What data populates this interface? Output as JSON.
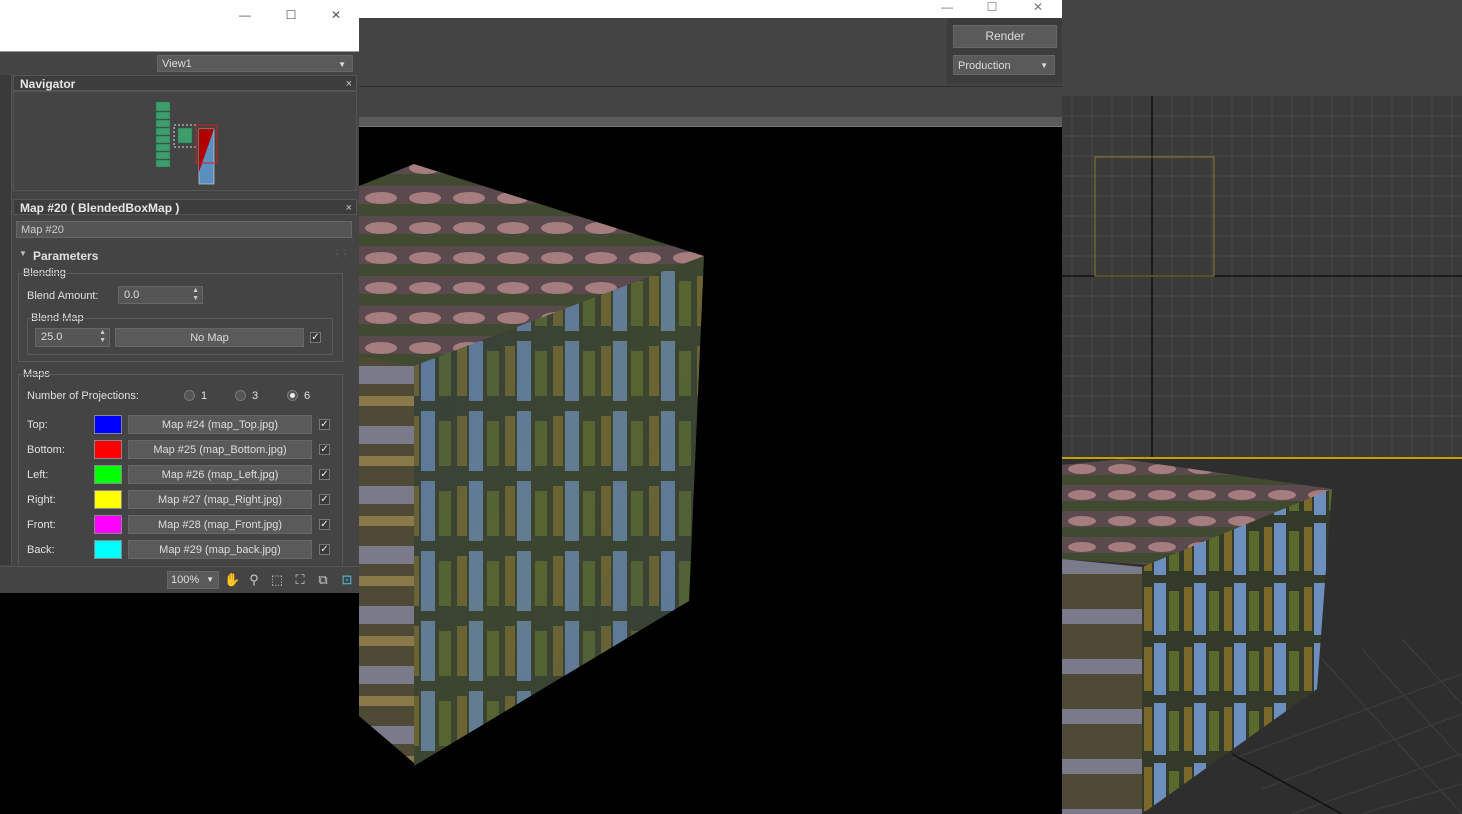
{
  "material_editor": {
    "view_select": "View1",
    "navigator": {
      "title": "Navigator",
      "close": "×"
    },
    "map_panel": {
      "title": "Map #20  ( BlendedBoxMap )",
      "close": "×",
      "map_name": "Map #20",
      "parameters_title": "Parameters",
      "blending": {
        "group_label": "Blending",
        "blend_amount_label": "Blend Amount:",
        "blend_amount_value": "0.0",
        "blend_map_label": "Blend Map",
        "blend_map_value": "25.0",
        "blend_map_button": "No Map",
        "blend_map_enabled": true
      },
      "maps": {
        "group_label": "Maps",
        "projections_label": "Number of Projections:",
        "projection_options": [
          "1",
          "3",
          "6"
        ],
        "projection_selected": "6",
        "rows": [
          {
            "label": "Top:",
            "color": "#0000ff",
            "map": "Map #24 (map_Top.jpg)",
            "enabled": true
          },
          {
            "label": "Bottom:",
            "color": "#ff0000",
            "map": "Map #25 (map_Bottom.jpg)",
            "enabled": true
          },
          {
            "label": "Left:",
            "color": "#00ff00",
            "map": "Map #26 (map_Left.jpg)",
            "enabled": true
          },
          {
            "label": "Right:",
            "color": "#ffff00",
            "map": "Map #27 (map_Right.jpg)",
            "enabled": true
          },
          {
            "label": "Front:",
            "color": "#ff00ff",
            "map": "Map #28 (map_Front.jpg)",
            "enabled": true
          },
          {
            "label": "Back:",
            "color": "#00ffff",
            "map": "Map #29 (map_back.jpg)",
            "enabled": true
          }
        ]
      }
    },
    "zoom": "100%",
    "window_controls": {
      "minimize": "—",
      "maximize": "☐",
      "close": "✕"
    }
  },
  "render_window": {
    "render_button": "Render",
    "preset_select": "Production",
    "window_controls": {
      "minimize": "—",
      "maximize": "☐",
      "close": "✕"
    }
  },
  "colors": {
    "node_green": "#3d9e6b",
    "node_red": "#b00000",
    "node_blue": "#5b8fbf",
    "viewport_select": "#c8a000"
  }
}
